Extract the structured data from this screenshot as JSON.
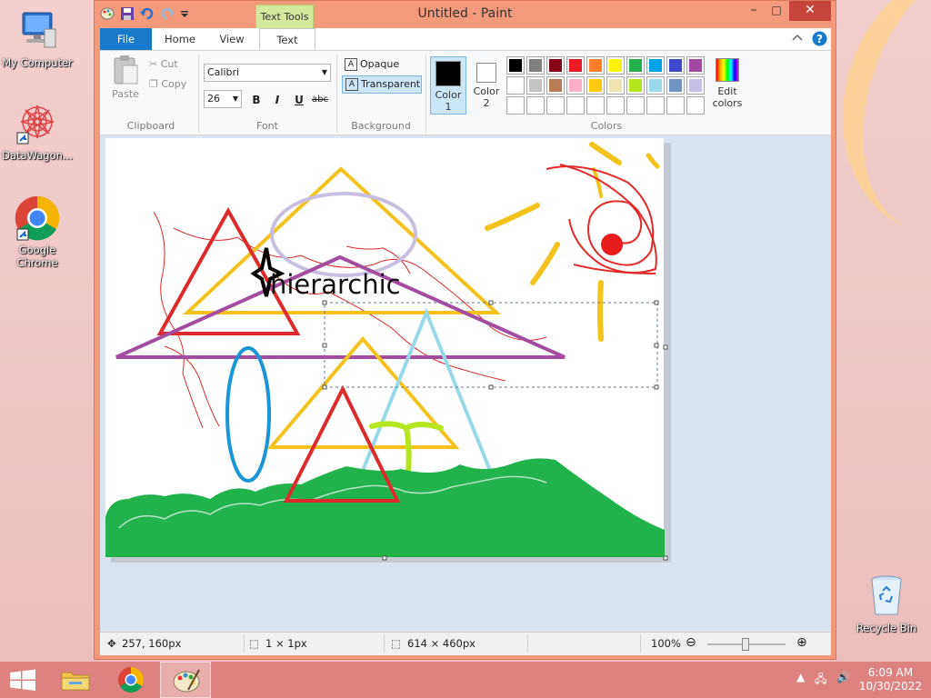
{
  "desktop": {
    "icons": [
      {
        "label": "My Computer"
      },
      {
        "label": "DataWagon..."
      },
      {
        "label": "Google Chrome"
      },
      {
        "label": "Recycle Bin"
      }
    ]
  },
  "window": {
    "title": "Untitled - Paint",
    "context_tab": "Text Tools",
    "controls": {
      "minimize": "–",
      "maximize": "□",
      "close": "✕"
    }
  },
  "ribbon": {
    "tabs": [
      "File",
      "Home",
      "View",
      "Text"
    ],
    "active_tab": "Text",
    "clipboard": {
      "paste": "Paste",
      "cut": "Cut",
      "copy": "Copy",
      "label": "Clipboard"
    },
    "font": {
      "family": "Calibri",
      "size": "26",
      "bold": "B",
      "italic": "I",
      "underline": "U",
      "strike": "abc",
      "label": "Font"
    },
    "background": {
      "opaque": "Opaque",
      "transparent": "Transparent",
      "selected": "Transparent",
      "label": "Background"
    },
    "colors": {
      "color1_label": "Color 1",
      "color1_value": "#000000",
      "color2_label": "Color 2",
      "color2_value": "#ffffff",
      "edit_label": "Edit colors",
      "label": "Colors",
      "palette": [
        "#000000",
        "#7f7f7f",
        "#880015",
        "#ed1c24",
        "#ff7f27",
        "#fff200",
        "#22b14c",
        "#00a2e8",
        "#3f48cc",
        "#a349a4",
        "#ffffff",
        "#c3c3c3",
        "#b97a57",
        "#ffaec9",
        "#ffc90e",
        "#efe4b0",
        "#b5e61d",
        "#99d9ea",
        "#7092be",
        "#c8bfe7",
        "#ffffff",
        "#ffffff",
        "#ffffff",
        "#ffffff",
        "#ffffff",
        "#ffffff",
        "#ffffff",
        "#ffffff",
        "#ffffff",
        "#ffffff"
      ]
    }
  },
  "canvas": {
    "text": "hierarchic"
  },
  "status": {
    "cursor_pos": "257, 160px",
    "selection_size": "1 × 1px",
    "image_size": "614 × 460px",
    "zoom": "100%",
    "zoom_out": "⊖",
    "zoom_in": "⊕"
  },
  "taskbar": {
    "time": "6:09 AM",
    "date": "10/30/2022"
  }
}
